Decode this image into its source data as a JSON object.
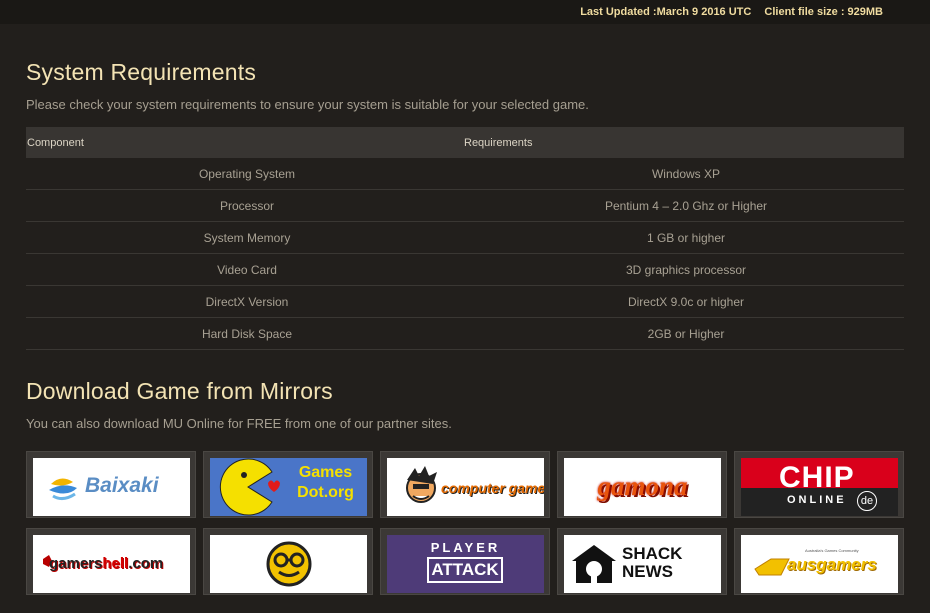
{
  "header": {
    "last_updated": "Last Updated :March 9 2016 UTC",
    "client_size": "Client file size : 929MB"
  },
  "requirements": {
    "title": "System Requirements",
    "subtitle": "Please check your system requirements to ensure your system is suitable for your selected game.",
    "columns": [
      "Component",
      "Requirements"
    ],
    "rows": [
      [
        "Operating System",
        "Windows XP"
      ],
      [
        "Processor",
        "Pentium 4 – 2.0 Ghz or Higher"
      ],
      [
        "System Memory",
        "1 GB or higher"
      ],
      [
        "Video Card",
        "3D graphics processor"
      ],
      [
        "DirectX Version",
        "DirectX 9.0c or higher"
      ],
      [
        "Hard Disk Space",
        "2GB or Higher"
      ]
    ]
  },
  "mirrors": {
    "title": "Download Game from Mirrors",
    "subtitle": "You can also download MU Online for FREE from one of our partner sites.",
    "sites": [
      {
        "name": "Baixaki",
        "icon": "baixaki-logo"
      },
      {
        "name": "Games Dot.org",
        "line1": "Games",
        "line2": "Dot.org",
        "icon": "pacman-logo"
      },
      {
        "name": "computer games",
        "icon": "computer-games-logo"
      },
      {
        "name": "gamona",
        "icon": "gamona-logo"
      },
      {
        "name": "CHIP ONLINE de",
        "line1": "CHIP",
        "line2": "ONLINE",
        "badge": "de",
        "icon": "chip-logo"
      },
      {
        "name": "gamershell.com",
        "pre": "gamers",
        "hl": "hell",
        "post": ".com",
        "icon": "gamershell-logo"
      },
      {
        "name": "",
        "icon": "smiley-glasses-logo"
      },
      {
        "name": "PLAYER ATTACK",
        "line1": "PLAYER",
        "line2": "ATTACK",
        "icon": "player-attack-logo"
      },
      {
        "name": "SHACK NEWS",
        "line1": "SHACK",
        "line2": "NEWS",
        "icon": "shacknews-logo"
      },
      {
        "name": "ausgamers",
        "tagline": "Australia's Games Community",
        "icon": "ausgamers-logo"
      }
    ]
  }
}
